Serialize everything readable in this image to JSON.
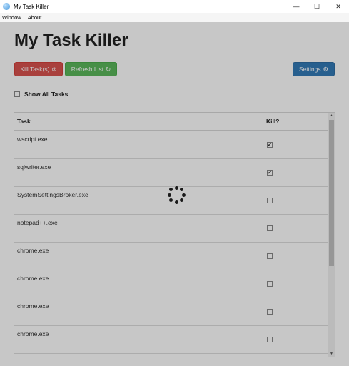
{
  "window": {
    "title": "My Task Killer",
    "minimize_glyph": "—",
    "maximize_glyph": "☐",
    "close_glyph": "✕"
  },
  "menu": {
    "items": [
      "Window",
      "About"
    ]
  },
  "page": {
    "title": "My Task Killer"
  },
  "toolbar": {
    "kill_label": "Kill Task(s)",
    "kill_icon": "⊗",
    "refresh_label": "Refresh List",
    "refresh_icon": "↻",
    "settings_label": "Settings",
    "settings_icon": "⚙"
  },
  "show_all": {
    "label": "Show All Tasks",
    "checked": false
  },
  "table": {
    "columns": [
      "Task",
      "Kill?"
    ],
    "rows": [
      {
        "task": "wscript.exe",
        "kill": true
      },
      {
        "task": "sqlwriter.exe",
        "kill": true
      },
      {
        "task": "SystemSettingsBroker.exe",
        "kill": false
      },
      {
        "task": "notepad++.exe",
        "kill": false
      },
      {
        "task": "chrome.exe",
        "kill": false
      },
      {
        "task": "chrome.exe",
        "kill": false
      },
      {
        "task": "chrome.exe",
        "kill": false
      },
      {
        "task": "chrome.exe",
        "kill": false
      }
    ]
  },
  "scroll": {
    "up_glyph": "▲",
    "down_glyph": "▼"
  },
  "colors": {
    "kill_button": "#d9534f",
    "refresh_button": "#5cb85c",
    "settings_button": "#337ab7"
  },
  "state": {
    "loading": true
  }
}
